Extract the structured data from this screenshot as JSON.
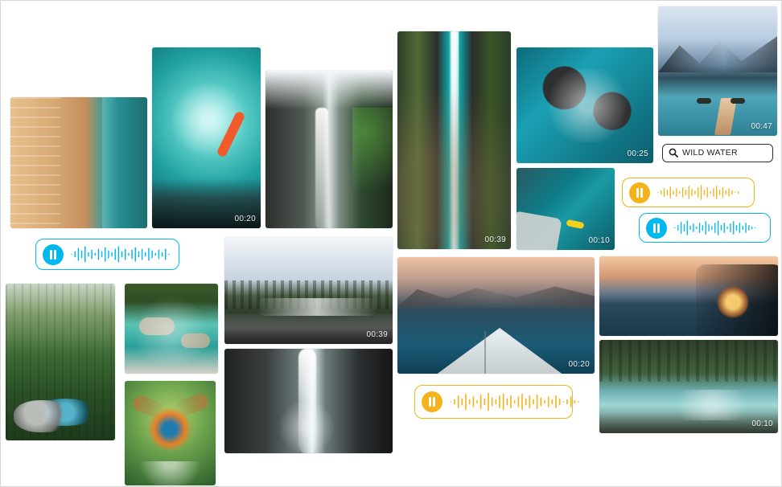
{
  "search": {
    "value": "WILD WATER",
    "icon": "search-icon"
  },
  "tiles": {
    "beach": {
      "time": ""
    },
    "kayak": {
      "time": "00:20"
    },
    "waterfall": {
      "time": ""
    },
    "canyon": {
      "time": "00:39"
    },
    "rocks": {
      "time": "00:25"
    },
    "lake": {
      "time": "00:47"
    },
    "boat_yellow": {
      "time": "00:10"
    },
    "forest": {
      "time": ""
    },
    "pool": {
      "time": ""
    },
    "kingfisher": {
      "time": ""
    },
    "rapids": {
      "time": "00:39"
    },
    "falls2": {
      "time": ""
    },
    "bow": {
      "time": "00:20"
    },
    "car": {
      "time": ""
    },
    "river": {
      "time": "00:10"
    }
  },
  "audio": {
    "left": {
      "color": "#00b8f0",
      "icon": "pause-icon"
    },
    "right_top": {
      "color": "#f6b21a",
      "icon": "pause-icon"
    },
    "right_bottom": {
      "color": "#00b8f0",
      "icon": "pause-icon"
    },
    "center": {
      "color": "#f6b21a",
      "icon": "pause-icon"
    }
  }
}
